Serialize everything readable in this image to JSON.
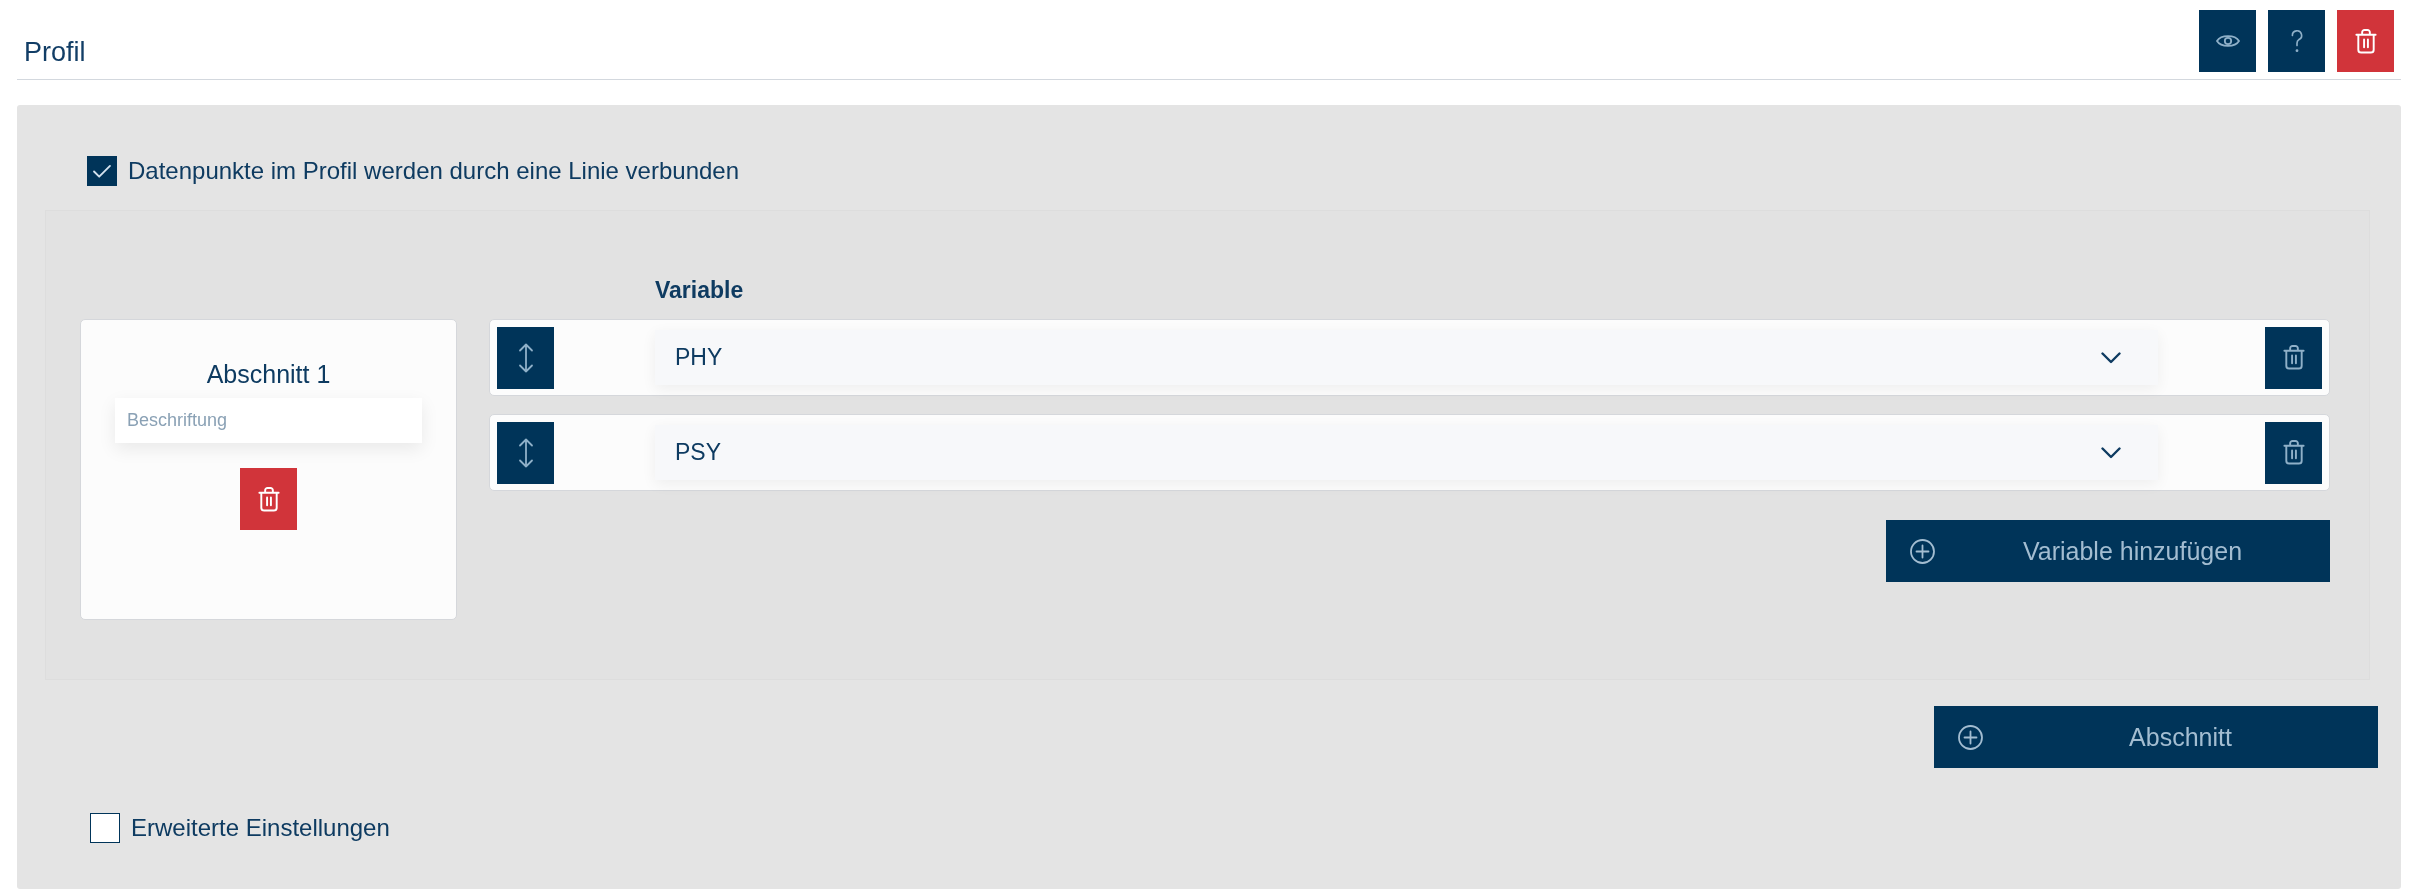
{
  "header": {
    "title": "Profil"
  },
  "connect_points": {
    "label": "Datenpunkte im Profil werden durch eine Linie verbunden",
    "checked": true
  },
  "sections": [
    {
      "title": "Abschnitt 1",
      "caption": {
        "placeholder": "Beschriftung"
      },
      "variable_heading": "Variable",
      "variables": [
        {
          "value": "PHY"
        },
        {
          "value": "PSY"
        }
      ],
      "add_variable_button": "Variable hinzufügen"
    }
  ],
  "add_section_button": "Abschnitt",
  "advanced_settings": {
    "label": "Erweiterte Einstellungen",
    "checked": false
  }
}
